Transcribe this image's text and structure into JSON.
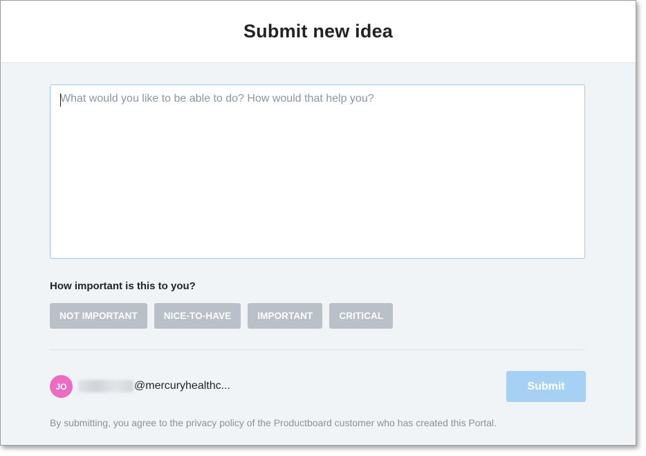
{
  "modal": {
    "title": "Submit new idea",
    "textarea_placeholder": "What would you like to be able to do? How would that help you?",
    "importance_label": "How important is this to you?",
    "importance_options": [
      "NOT IMPORTANT",
      "NICE-TO-HAVE",
      "IMPORTANT",
      "CRITICAL"
    ],
    "user": {
      "avatar_initials": "JO",
      "email_domain": "@mercuryhealthc..."
    },
    "submit_label": "Submit",
    "disclaimer": "By submitting, you agree to the privacy policy of the Productboard customer who has created this Portal."
  },
  "colors": {
    "header_bg": "#ffffff",
    "body_bg": "#f1f4f7",
    "chip_bg": "#b9c0c7",
    "submit_bg": "#a6d1f5",
    "avatar_bg": "#ec6cc3",
    "textarea_border": "#9fc7ea"
  }
}
